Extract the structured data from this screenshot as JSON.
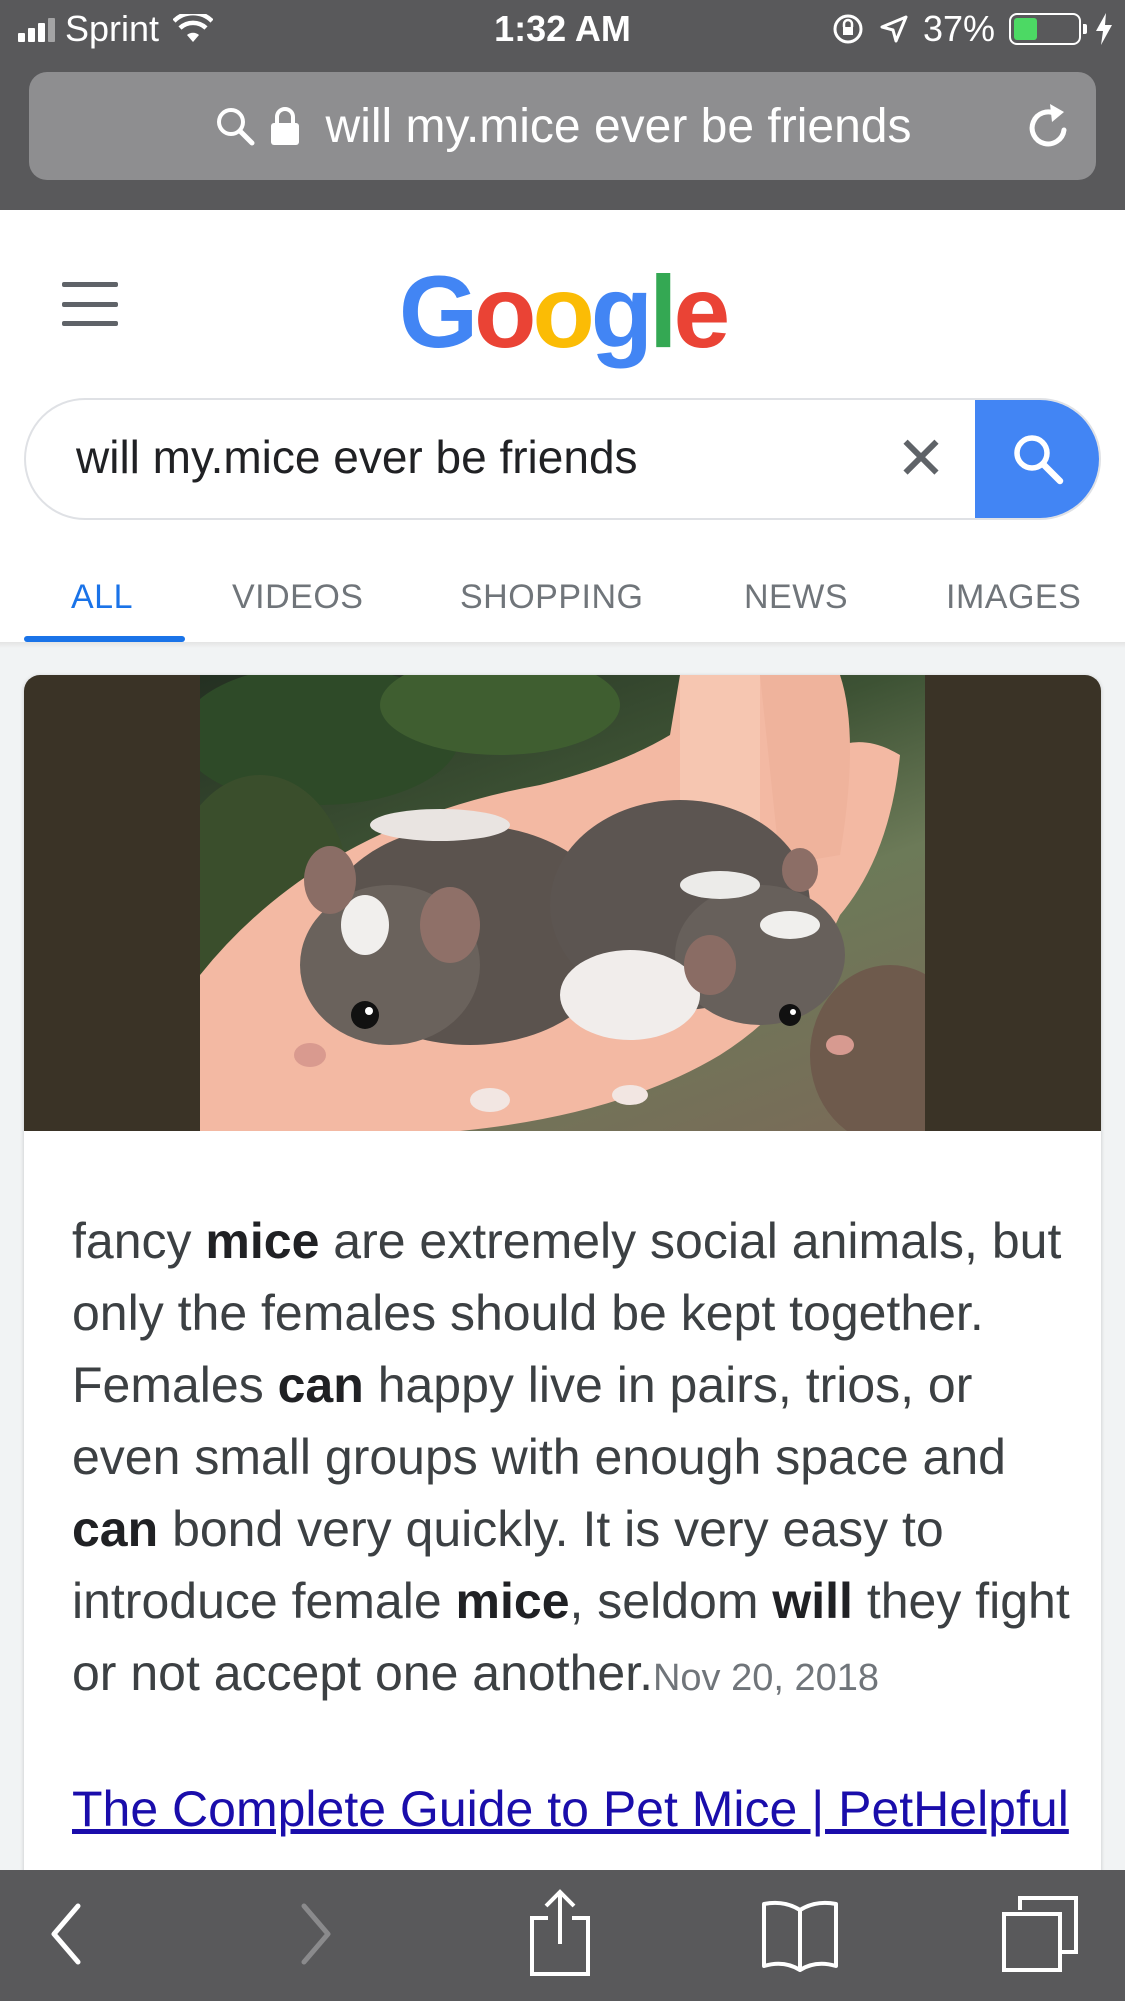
{
  "status_bar": {
    "carrier": "Sprint",
    "time": "1:32 AM",
    "battery_text": "37%",
    "battery_level": 0.37
  },
  "url_bar": {
    "text": "will my.mice ever be friends"
  },
  "google": {
    "logo_letters": [
      {
        "ch": "G",
        "color": "#4285f4"
      },
      {
        "ch": "o",
        "color": "#ea4335"
      },
      {
        "ch": "o",
        "color": "#fbbc05"
      },
      {
        "ch": "g",
        "color": "#4285f4"
      },
      {
        "ch": "l",
        "color": "#34a853"
      },
      {
        "ch": "e",
        "color": "#ea4335"
      }
    ],
    "search_query": "will my.mice ever be friends",
    "clear_glyph": "✕",
    "tabs": [
      "ALL",
      "VIDEOS",
      "SHOPPING",
      "NEWS",
      "IMAGES"
    ],
    "active_tab": "ALL"
  },
  "featured_snippet": {
    "segments": [
      {
        "t": "fancy ",
        "b": false
      },
      {
        "t": "mice",
        "b": true
      },
      {
        "t": " are extremely social animals, but only the females should be kept together. Females ",
        "b": false
      },
      {
        "t": "can",
        "b": true
      },
      {
        "t": " happy live in pairs, trios, or even small groups with enough space and ",
        "b": false
      },
      {
        "t": "can",
        "b": true
      },
      {
        "t": " bond very quickly. It is very easy to introduce female ",
        "b": false
      },
      {
        "t": "mice",
        "b": true
      },
      {
        "t": ", seldom ",
        "b": false
      },
      {
        "t": "will",
        "b": true
      },
      {
        "t": " they fight or not accept one another.",
        "b": false
      }
    ],
    "date": "Nov 20, 2018",
    "result_title": "The Complete Guide to Pet Mice | PetHelpful"
  },
  "colors": {
    "accent_blue": "#1a73e8",
    "search_button": "#4285f4",
    "chrome_gray": "#59595b"
  },
  "icons": [
    "search-icon",
    "lock-icon",
    "reload-icon",
    "hamburger-icon",
    "clear-icon",
    "back-icon",
    "forward-icon",
    "share-icon",
    "bookmarks-icon",
    "tabs-icon"
  ]
}
